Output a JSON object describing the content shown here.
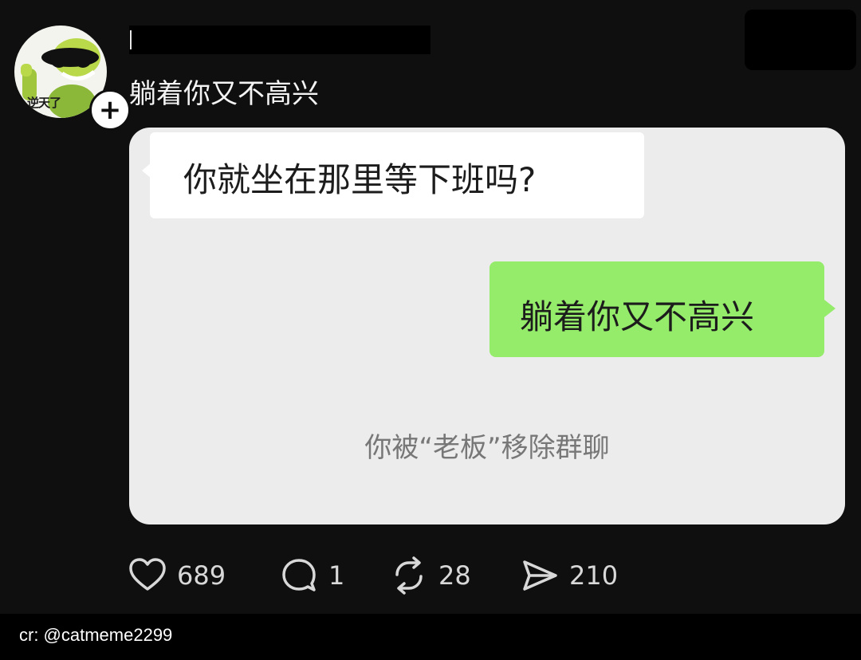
{
  "avatar": {
    "caption": "逆天了",
    "follow_icon": "plus-icon"
  },
  "post": {
    "text": "躺着你又不高兴"
  },
  "chat": {
    "incoming_message": "你就坐在那里等下班吗?",
    "outgoing_message": "躺着你又不高兴",
    "system_notice": "你被“老板”移除群聊"
  },
  "actions": {
    "likes": "689",
    "comments": "1",
    "reposts": "28",
    "shares": "210"
  },
  "footer": {
    "credit": "cr:  @catmeme2299"
  },
  "colors": {
    "background": "#0f0f0f",
    "outgoing_bubble": "#95eb6a",
    "card": "#ececec"
  }
}
